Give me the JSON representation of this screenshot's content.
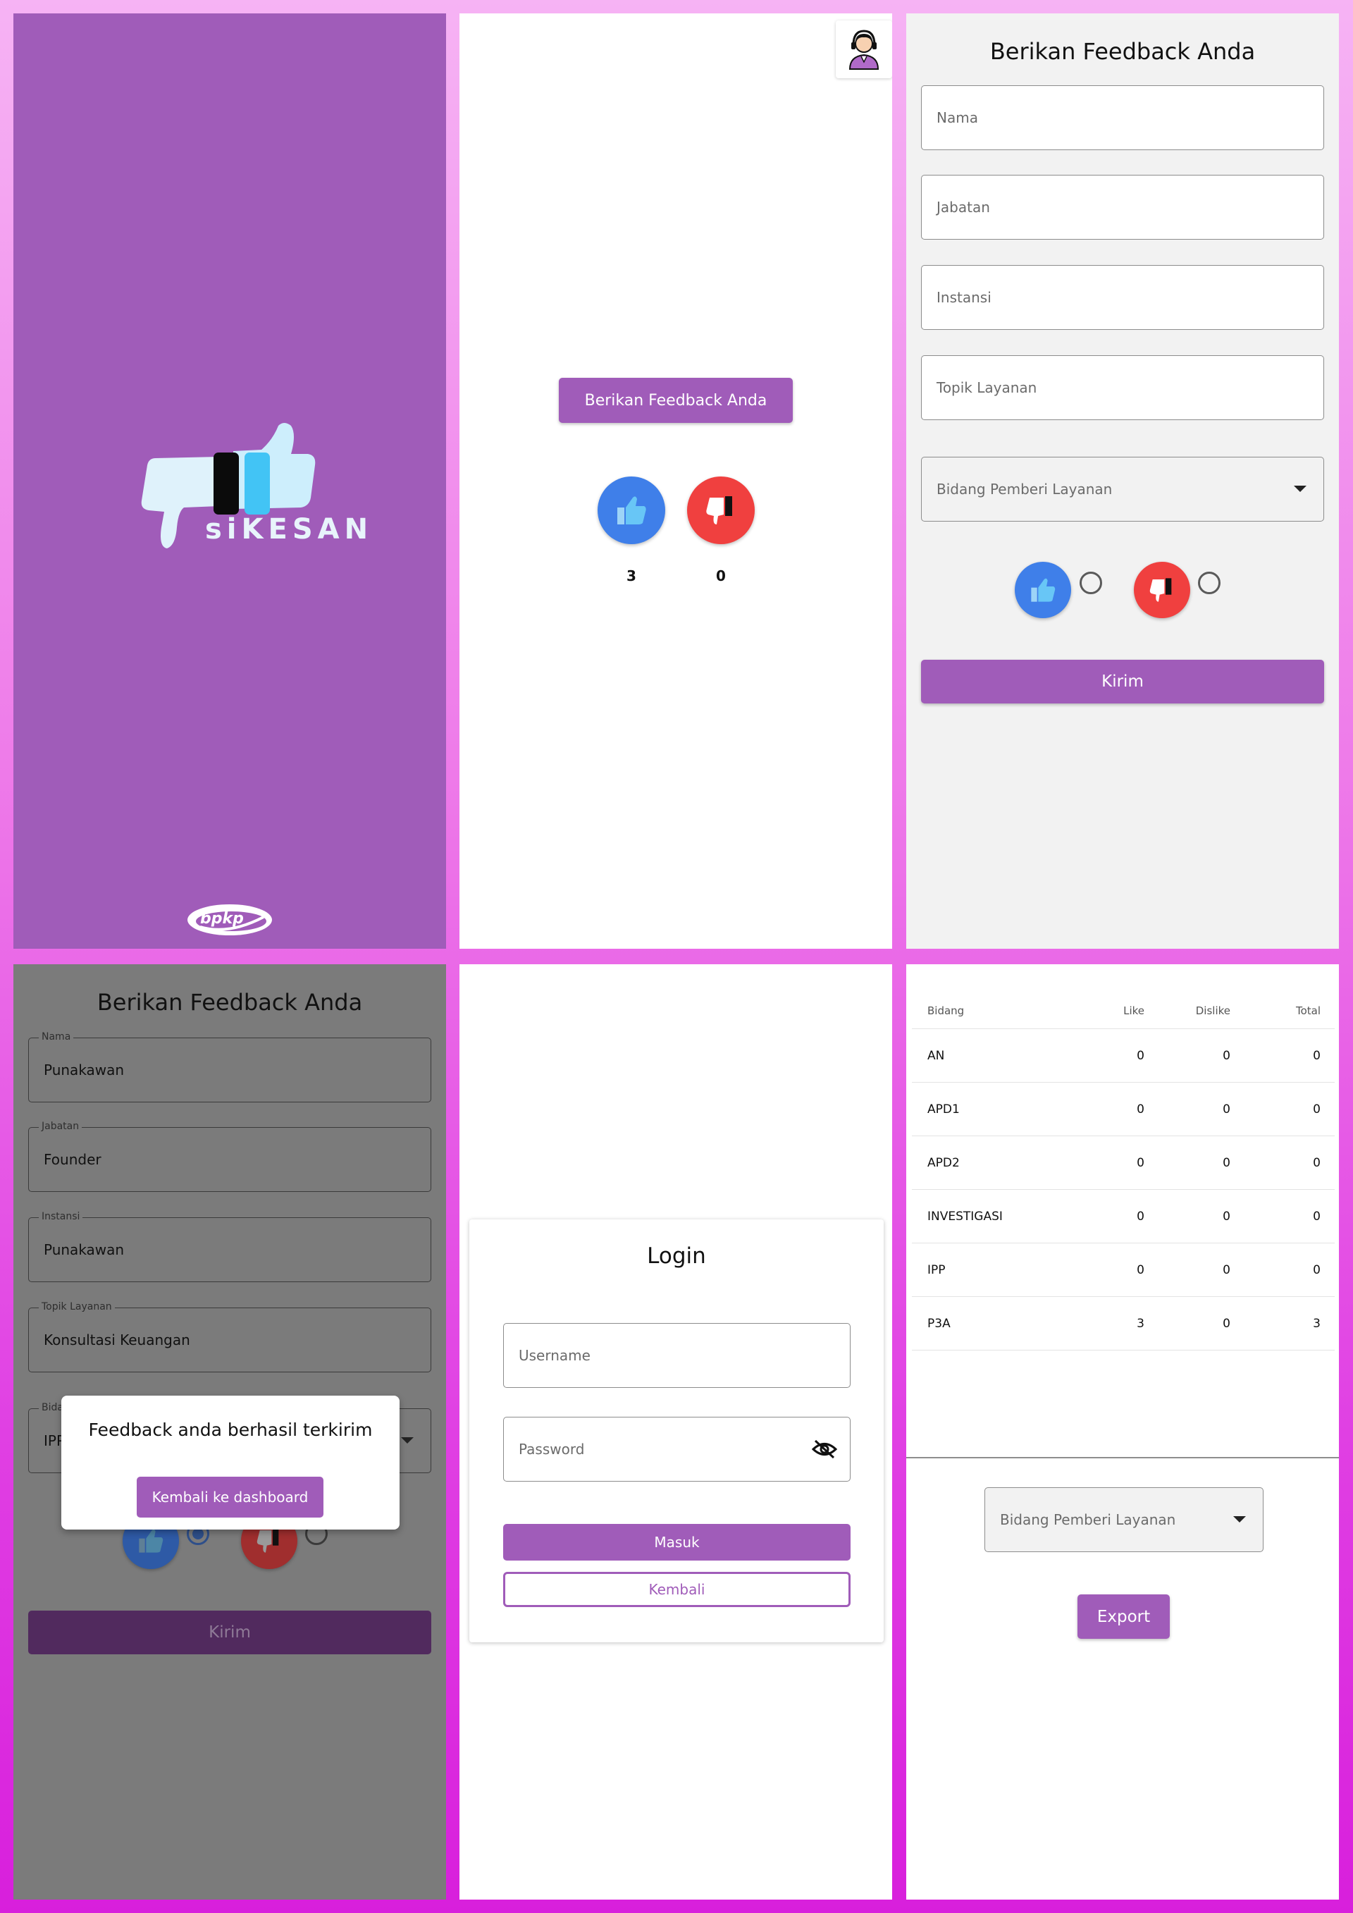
{
  "splash": {
    "app_name": "siKESAN",
    "footer_logo": "bpkp"
  },
  "home": {
    "feedback_button": "Berikan Feedback Anda",
    "like_count": "3",
    "dislike_count": "0"
  },
  "form": {
    "title": "Berikan Feedback Anda",
    "nama_placeholder": "Nama",
    "jabatan_placeholder": "Jabatan",
    "instansi_placeholder": "Instansi",
    "topik_placeholder": "Topik Layanan",
    "bidang_placeholder": "Bidang Pemberi Layanan",
    "submit_label": "Kirim"
  },
  "form_filled": {
    "title": "Berikan Feedback Anda",
    "nama_label": "Nama",
    "nama_value": "Punakawan",
    "jabatan_label": "Jabatan",
    "jabatan_value": "Founder",
    "instansi_label": "Instansi",
    "instansi_value": "Punakawan",
    "topik_label": "Topik Layanan",
    "topik_value": "Konsultasi Keuangan",
    "bidang_label": "Bidang",
    "bidang_value": "IPP",
    "submit_label": "Kirim",
    "dialog_message": "Feedback anda berhasil terkirim",
    "dialog_button": "Kembali ke dashboard"
  },
  "login": {
    "title": "Login",
    "username_placeholder": "Username",
    "password_placeholder": "Password",
    "submit_label": "Masuk",
    "back_label": "Kembali"
  },
  "report": {
    "columns": [
      "Bidang",
      "Like",
      "Dislike",
      "Total"
    ],
    "rows": [
      [
        "AN",
        "0",
        "0",
        "0"
      ],
      [
        "APD1",
        "0",
        "0",
        "0"
      ],
      [
        "APD2",
        "0",
        "0",
        "0"
      ],
      [
        "INVESTIGASI",
        "0",
        "0",
        "0"
      ],
      [
        "IPP",
        "0",
        "0",
        "0"
      ],
      [
        "P3A",
        "3",
        "0",
        "3"
      ]
    ],
    "filter_placeholder": "Bidang Pemberi Layanan",
    "export_label": "Export"
  },
  "colors": {
    "primary": "#a05cb9",
    "like_blue": "#3f7fe9",
    "dislike_red": "#f0403f"
  },
  "icons": [
    "thumbs-up-icon",
    "thumbs-down-icon",
    "customer-service-icon",
    "eye-off-icon",
    "chevron-down-icon"
  ]
}
